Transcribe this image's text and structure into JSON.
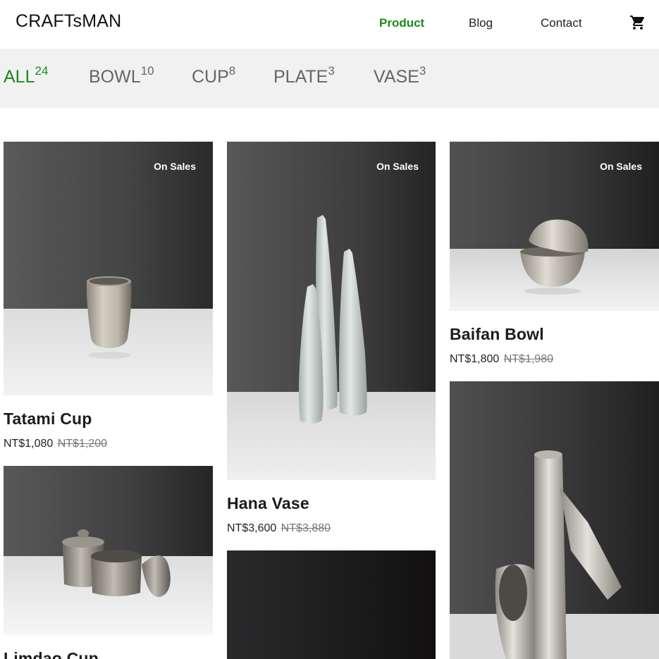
{
  "brand": {
    "logo": "CRAFTsMAN"
  },
  "nav": {
    "items": [
      {
        "label": "Product",
        "active": true
      },
      {
        "label": "Blog",
        "active": false
      },
      {
        "label": "Contact",
        "active": false
      }
    ],
    "cart_icon": "shopping-cart-icon"
  },
  "categories": [
    {
      "label": "ALL",
      "count": "24",
      "active": true
    },
    {
      "label": "BOWL",
      "count": "10",
      "active": false
    },
    {
      "label": "CUP",
      "count": "8",
      "active": false
    },
    {
      "label": "PLATE",
      "count": "3",
      "active": false
    },
    {
      "label": "VASE",
      "count": "3",
      "active": false
    }
  ],
  "products": [
    {
      "name": "Tatami Cup",
      "price": "NT$1,080",
      "original_price": "NT$1,200",
      "badge": "On Sales"
    },
    {
      "name": "Hana Vase",
      "price": "NT$3,600",
      "original_price": "NT$3,880",
      "badge": "On Sales"
    },
    {
      "name": "Baifan Bowl",
      "price": "NT$1,800",
      "original_price": "NT$1,980",
      "badge": "On Sales"
    },
    {
      "name": "Limdao Cup"
    }
  ],
  "colors": {
    "accent": "#1a8a1a",
    "category_bar": "#f1f1f1",
    "text": "#1c1c1c"
  }
}
